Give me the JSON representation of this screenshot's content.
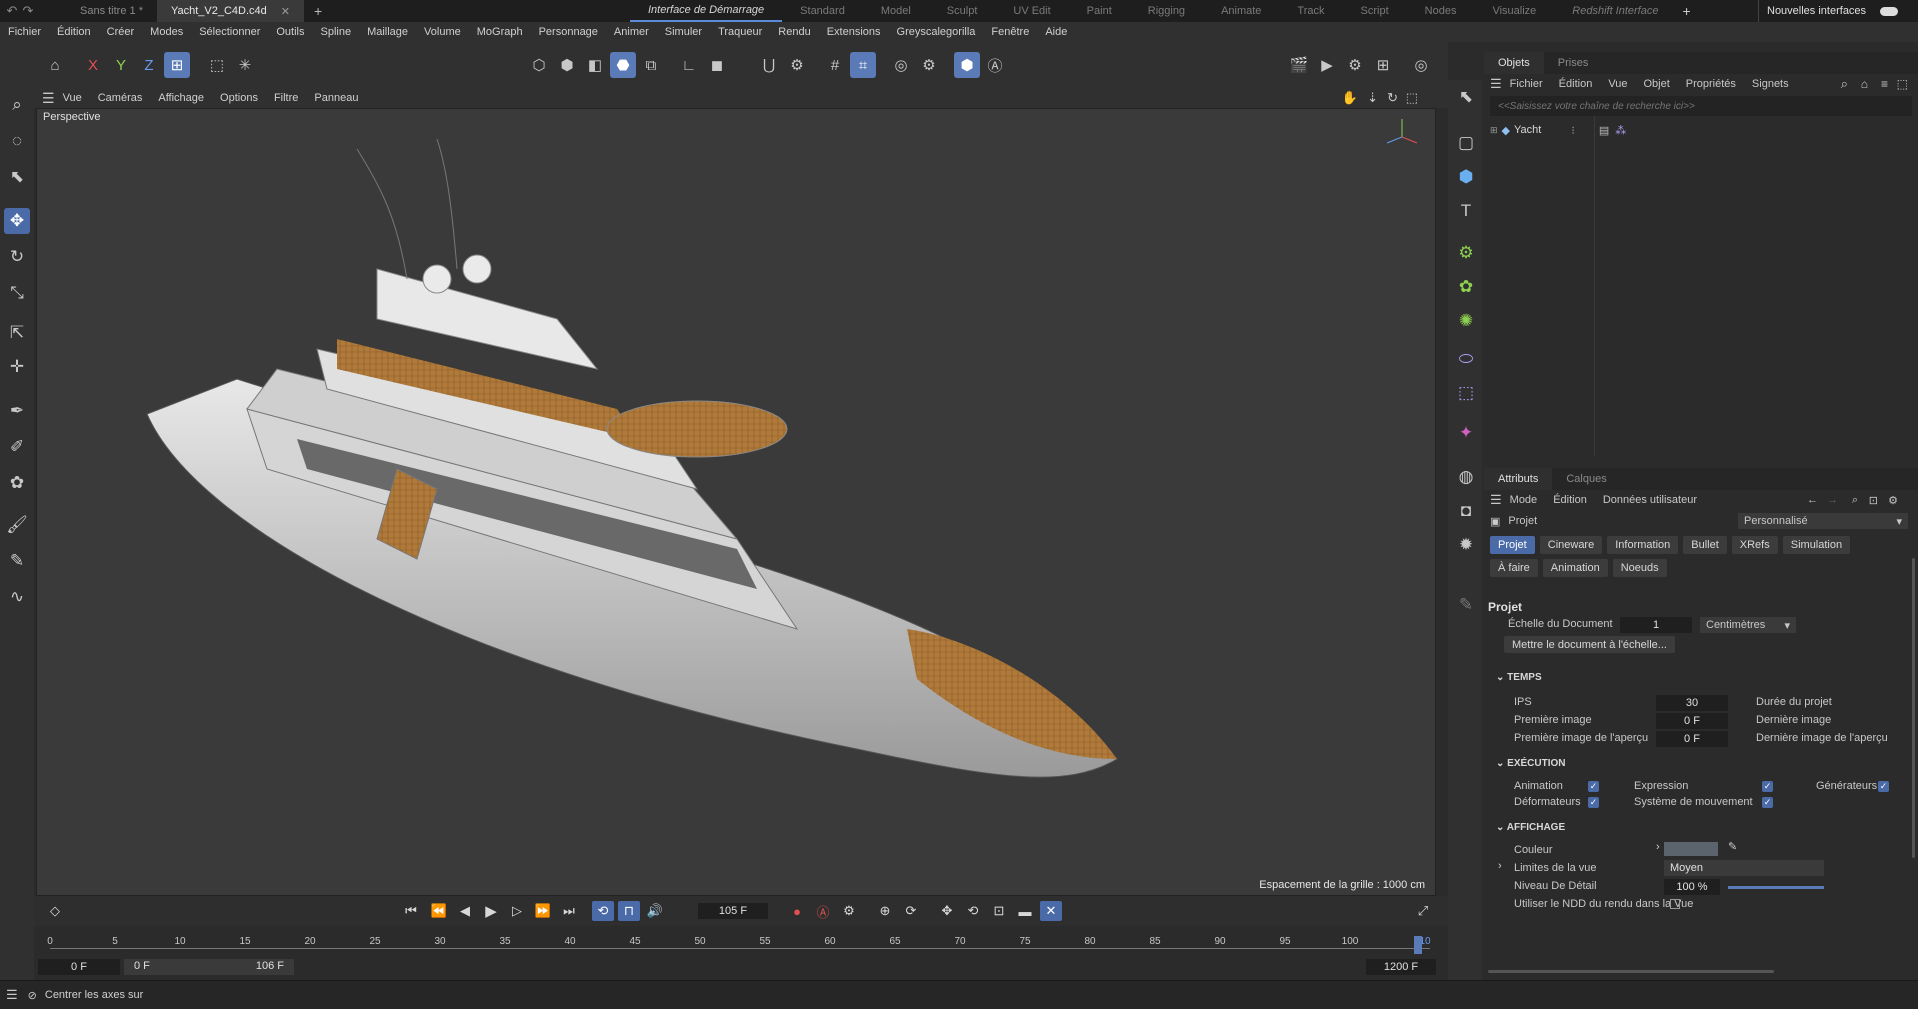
{
  "window": {
    "tabs": [
      {
        "label": "Sans titre 1 *"
      },
      {
        "label": "Yacht_V2_C4D.c4d"
      }
    ],
    "new_tab": "+",
    "close": "✕"
  },
  "layouts": [
    "Interface de Démarrage",
    "Standard",
    "Model",
    "Sculpt",
    "UV Edit",
    "Paint",
    "Rigging",
    "Animate",
    "Track",
    "Script",
    "Nodes",
    "Visualize",
    "Redshift Interface"
  ],
  "layouts_add": "+",
  "new_interfaces": "Nouvelles interfaces",
  "menu": [
    "Fichier",
    "Édition",
    "Créer",
    "Modes",
    "Sélectionner",
    "Outils",
    "Spline",
    "Maillage",
    "Volume",
    "MoGraph",
    "Personnage",
    "Animer",
    "Simuler",
    "Traqueur",
    "Rendu",
    "Extensions",
    "Greyscalegorilla",
    "Fenêtre",
    "Aide"
  ],
  "axes": {
    "x": "X",
    "y": "Y",
    "z": "Z"
  },
  "viewport": {
    "menu": [
      "Vue",
      "Caméras",
      "Affichage",
      "Options",
      "Filtre",
      "Panneau"
    ],
    "label": "Perspective",
    "grid_info": "Espacement de la grille : 1000 cm"
  },
  "objects": {
    "tabs": [
      "Objets",
      "Prises"
    ],
    "menu": [
      "Fichier",
      "Édition",
      "Vue",
      "Objet",
      "Propriétés",
      "Signets"
    ],
    "search_placeholder": "<<Saisissez votre chaîne de recherche ici>>",
    "items": [
      {
        "name": "Yacht"
      }
    ]
  },
  "attributes": {
    "tabs": [
      "Attributs",
      "Calques"
    ],
    "menu": [
      "Mode",
      "Édition",
      "Données utilisateur"
    ],
    "object": "Projet",
    "preset": "Personnalisé",
    "buttons_row1": [
      "Projet",
      "Cineware",
      "Information",
      "Bullet",
      "XRefs",
      "Simulation"
    ],
    "buttons_row2": [
      "À faire",
      "Animation",
      "Noeuds"
    ],
    "section_title": "Projet",
    "doc_scale_label": "Échelle du Document",
    "doc_scale_value": "1",
    "doc_scale_unit": "Centimètres",
    "scale_doc_btn": "Mettre le document à l'échelle...",
    "temps": {
      "title": "TEMPS",
      "ips_label": "IPS",
      "ips_value": "30",
      "duration_label": "Durée du projet",
      "first_label": "Première image",
      "first_value": "0 F",
      "last_label": "Dernière image",
      "preview_first_label": "Première image de l'aperçu",
      "preview_first_value": "0 F",
      "preview_last_label": "Dernière image de l'aperçu"
    },
    "execution": {
      "title": "EXÉCUTION",
      "animation": "Animation",
      "expression": "Expression",
      "generators": "Générateurs",
      "deformers": "Déformateurs",
      "motion": "Système de mouvement"
    },
    "affichage": {
      "title": "AFFICHAGE",
      "color_label": "Couleur",
      "limits_label": "Limites de la vue",
      "limits_value": "Moyen",
      "lod_label": "Niveau De Détail",
      "lod_value": "100 %",
      "ndd_label": "Utiliser le NDD du rendu dans la Vue"
    }
  },
  "timeline": {
    "current_frame": "105 F",
    "ticks": [
      "0",
      "5",
      "10",
      "15",
      "20",
      "25",
      "30",
      "35",
      "40",
      "45",
      "50",
      "55",
      "60",
      "65",
      "70",
      "75",
      "80",
      "85",
      "90",
      "95",
      "100"
    ],
    "end_tick": "10",
    "start": "0 F",
    "range_start": "0 F",
    "range_end": "106 F",
    "end": "1200 F"
  },
  "status": {
    "text": "Centrer les axes sur"
  }
}
